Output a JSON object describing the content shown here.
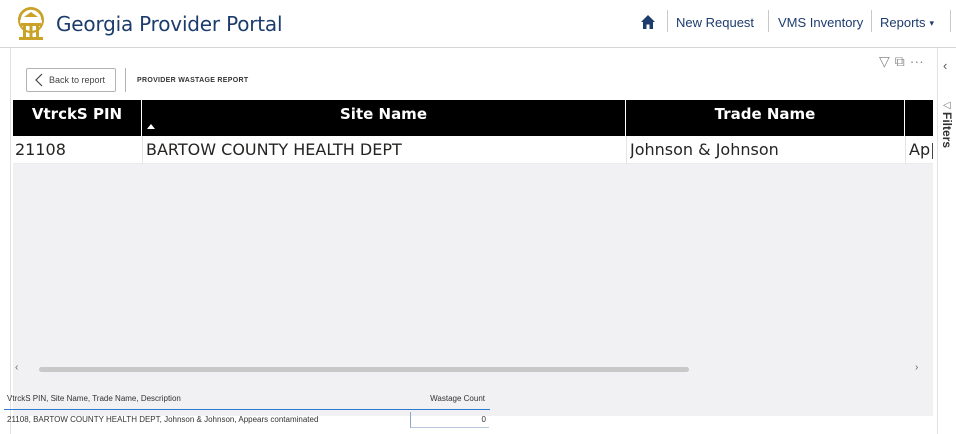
{
  "nav": {
    "brand": "Georgia Provider Portal",
    "links": {
      "new_request": "New Request",
      "vms_inventory": "VMS Inventory",
      "reports": "Reports"
    }
  },
  "report": {
    "back_label": "Back to report",
    "title": "PROVIDER WASTAGE REPORT",
    "columns": [
      "VtrckS PIN",
      "Site Name",
      "Trade Name"
    ],
    "rows": [
      {
        "pin": "21108",
        "site": "BARTOW COUNTY HEALTH DEPT",
        "trade": "Johnson & Johnson",
        "desc_partial": "Ap|"
      }
    ]
  },
  "summary": {
    "col1_header": "VtrckS PIN, Site Name, Trade Name, Description",
    "col2_header": "Wastage Count",
    "rows": [
      {
        "label": "21108, BARTOW COUNTY HEALTH DEPT, Johnson & Johnson, Appears contaminated",
        "count": "0"
      }
    ]
  },
  "filters": {
    "label": "Filters"
  },
  "colors": {
    "brand_navy": "#1d3c6e",
    "header_black": "#000000",
    "accent_gold": "#c9a227"
  }
}
